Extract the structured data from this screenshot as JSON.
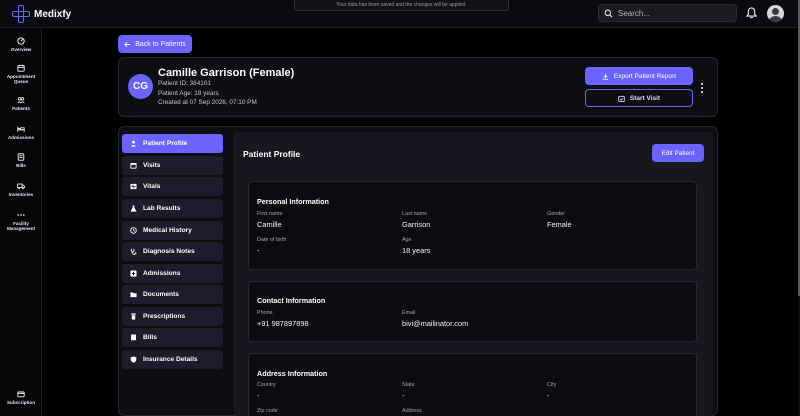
{
  "app": {
    "name": "Medixfy"
  },
  "toast": {
    "text": "Your data has been saved and the changes will be applied."
  },
  "search": {
    "placeholder": "Search..."
  },
  "sidebar": {
    "items": [
      {
        "label": "Overview",
        "icon": "gauge-icon"
      },
      {
        "label": "Appointment Queue",
        "icon": "calendar-icon"
      },
      {
        "label": "Patients",
        "icon": "users-icon"
      },
      {
        "label": "Admissions",
        "icon": "bed-icon"
      },
      {
        "label": "Bills",
        "icon": "receipt-icon"
      },
      {
        "label": "Inventories",
        "icon": "truck-icon"
      },
      {
        "label": "Facility Management",
        "icon": "dots-icon"
      },
      {
        "label": "Subscription",
        "icon": "wallet-icon"
      }
    ]
  },
  "back_button": {
    "label": "Back to Patients"
  },
  "patient": {
    "initials": "CG",
    "name": "Camille Garrison (Female)",
    "id_line": "Patient ID: 384101",
    "age_line": "Patient Age: 18 years",
    "created_line": "Created at 07 Sep 2026, 07:10 PM"
  },
  "actions": {
    "export_label": "Export Patient Report",
    "start_visit_label": "Start Visit"
  },
  "tabs": [
    {
      "label": "Patient Profile",
      "active": true
    },
    {
      "label": "Visits"
    },
    {
      "label": "Vitals"
    },
    {
      "label": "Lab Results"
    },
    {
      "label": "Medical History"
    },
    {
      "label": "Diagnosis Notes"
    },
    {
      "label": "Admissions"
    },
    {
      "label": "Documents"
    },
    {
      "label": "Prescriptions"
    },
    {
      "label": "Bills"
    },
    {
      "label": "Insurance Details"
    }
  ],
  "profile": {
    "title": "Patient Profile",
    "edit_label": "Edit Patient",
    "personal": {
      "title": "Personal Information",
      "first_name_label": "First name",
      "first_name": "Camille",
      "last_name_label": "Last name",
      "last_name": "Garrison",
      "gender_label": "Gender",
      "gender": "Female",
      "dob_label": "Date of birth",
      "dob": "-",
      "age_label": "Age",
      "age": "18 years"
    },
    "contact": {
      "title": "Contact Information",
      "phone_label": "Phone",
      "phone": "+91 987897898",
      "email_label": "Email",
      "email": "bivi@mailinator.com"
    },
    "address": {
      "title": "Address Information",
      "country_label": "Country",
      "country": "-",
      "state_label": "State",
      "state": "-",
      "city_label": "City",
      "city": "-",
      "zip_label": "Zip code",
      "address_label": "Address"
    }
  },
  "colors": {
    "accent": "#6b63ff",
    "tab_bg": "#1c1c2b",
    "background": "#000000"
  }
}
